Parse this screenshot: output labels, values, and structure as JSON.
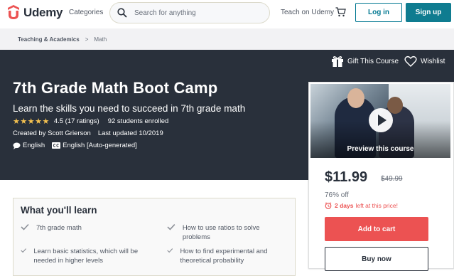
{
  "header": {
    "logo_text": "Udemy",
    "categories_label": "Categories",
    "search_placeholder": "Search for anything",
    "teach_label": "Teach on Udemy",
    "login_label": "Log in",
    "signup_label": "Sign up"
  },
  "breadcrumb": [
    "Teaching & Academics",
    ">",
    "Math"
  ],
  "hero": {
    "gift_label": "Gift This Course",
    "wishlist_label": "Wishlist",
    "title": "7th Grade Math Boot Camp",
    "subtitle": "Learn the skills you need to succeed in 7th grade math",
    "stars": "★★★★★",
    "rating": "4.5 (17 ratings)",
    "enrolled": "92 students enrolled",
    "created_by": "Created by Scott Grierson",
    "last_updated": "Last updated 10/2019",
    "language": "English",
    "captions": "English [Auto-generated]"
  },
  "sidebar": {
    "preview_label": "Preview this course",
    "price": "$11.99",
    "original_price": "$49.99",
    "discount": "76% off",
    "urgency_bold": "2 days",
    "urgency_rest": "left at this price!",
    "add_to_cart": "Add to cart",
    "buy_now": "Buy now"
  },
  "learn": {
    "title": "What you'll learn",
    "items": [
      "7th grade math",
      "How to use ratios to solve problems",
      "Learn basic statistics, which will be needed in higher levels",
      "How to find experimental and theoretical probability"
    ]
  },
  "colors": {
    "hero_bg": "#29303b",
    "primary": "#0f7c90",
    "cart_red": "#ec5252",
    "star": "#f4c150"
  }
}
